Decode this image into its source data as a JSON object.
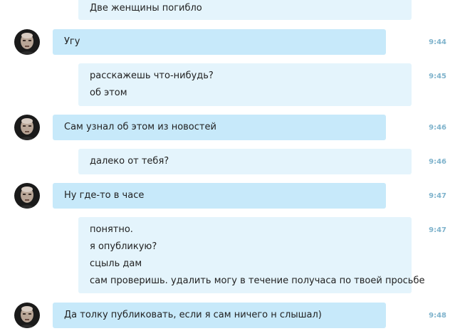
{
  "conversation": {
    "messages": [
      {
        "from": "outgoing",
        "time": "",
        "lines": [
          "Две женщины погибло"
        ]
      },
      {
        "from": "incoming",
        "time": "9:44",
        "lines": [
          "Угу"
        ]
      },
      {
        "from": "outgoing",
        "time": "9:45",
        "lines": [
          "расскажешь что-нибудь?",
          "об этом"
        ]
      },
      {
        "from": "incoming",
        "time": "9:46",
        "lines": [
          "Сам узнал об этом из новостей"
        ]
      },
      {
        "from": "outgoing",
        "time": "9:46",
        "lines": [
          "далеко от тебя?"
        ]
      },
      {
        "from": "incoming",
        "time": "9:47",
        "lines": [
          "Ну где-то в часе"
        ]
      },
      {
        "from": "outgoing",
        "time": "9:47",
        "lines": [
          "понятно.",
          "я опубликую?",
          "сцыль дам",
          "сам проверишь. удалить могу в течение получаса по твоей просьбе"
        ]
      },
      {
        "from": "incoming",
        "time": "9:48",
        "lines": [
          "Да толку публиковать, если я сам ничего н слышал)"
        ]
      }
    ]
  },
  "colors": {
    "incoming_bubble": "#c7e9fa",
    "outgoing_bubble": "#e4f4fc",
    "timestamp": "#7fb3cc"
  },
  "icons": {
    "avatar": "contact-avatar-photo"
  }
}
